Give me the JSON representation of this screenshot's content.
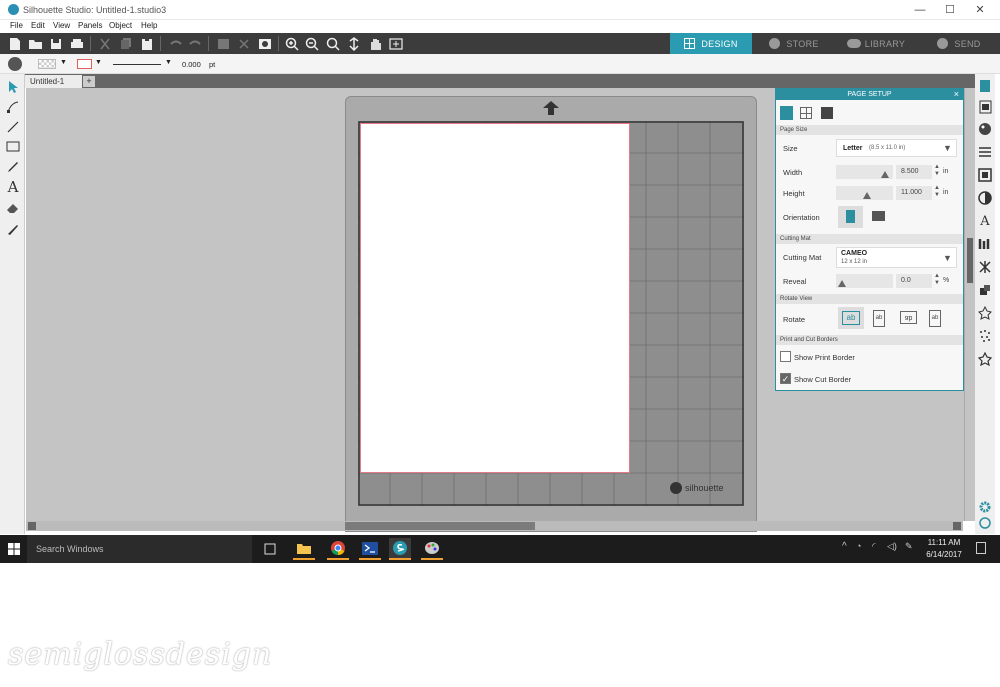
{
  "window": {
    "title": "Silhouette Studio: Untitled-1.studio3",
    "minimize": "—",
    "maximize": "☐",
    "close": "✕"
  },
  "menu": [
    "File",
    "Edit",
    "View",
    "Panels",
    "Object",
    "Help"
  ],
  "nav_tabs": [
    {
      "label": "DESIGN",
      "active": true
    },
    {
      "label": "STORE"
    },
    {
      "label": "LIBRARY"
    },
    {
      "label": "SEND"
    }
  ],
  "options": {
    "line_width": "0.000",
    "unit": "pt"
  },
  "doc_tab": {
    "name": "Untitled-1",
    "add": "+"
  },
  "panel": {
    "title": "PAGE SETUP",
    "close": "×",
    "sections": {
      "page_size": "Page Size",
      "cutting_mat": "Cutting Mat",
      "rotate_view": "Rotate View",
      "borders": "Print and Cut Borders"
    },
    "size": {
      "label": "Size",
      "value": "Letter",
      "detail": "(8.5 x 11.0 in)"
    },
    "width": {
      "label": "Width",
      "value": "8.500",
      "unit": "in"
    },
    "height": {
      "label": "Height",
      "value": "11.000",
      "unit": "in"
    },
    "orientation": {
      "label": "Orientation"
    },
    "cutting_mat": {
      "label": "Cutting Mat",
      "value": "CAMEO",
      "detail": "12 x 12 in"
    },
    "reveal": {
      "label": "Reveal",
      "value": "0.0",
      "unit": "%"
    },
    "rotate": {
      "label": "Rotate",
      "options": [
        "ab",
        "ab",
        "ab",
        "ab"
      ]
    },
    "show_print_border": {
      "label": "Show Print Border",
      "checked": false
    },
    "show_cut_border": {
      "label": "Show Cut Border",
      "checked": true
    }
  },
  "mat_brand": "silhouette",
  "taskbar": {
    "search_placeholder": "Search Windows",
    "time": "11:11 AM",
    "date": "6/14/2017"
  },
  "watermark": "semiglossdesign",
  "colors": {
    "accent": "#2b8fa0",
    "toolbar": "#3c3c3c",
    "design_tab": "#2a9bb0",
    "page_border": "#e47a8a"
  }
}
